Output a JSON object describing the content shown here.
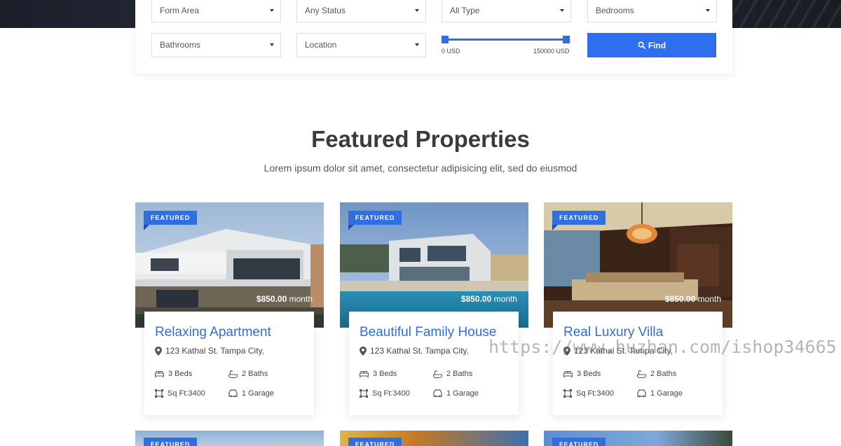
{
  "search": {
    "form_area": "Form Area",
    "status": "Any Status",
    "type": "All Type",
    "bedrooms": "Bedrooms",
    "bathrooms": "Bathrooms",
    "location": "Location",
    "price_min": "0 USD",
    "price_max": "150000 USD",
    "find_label": "Find"
  },
  "section": {
    "title": "Featured Properties",
    "subtitle": "Lorem ipsum dolor sit amet, consectetur adipisicing elit, sed do eiusmod"
  },
  "properties": [
    {
      "badge": "FEATURED",
      "price": "$850.00",
      "period": "month",
      "name": "Relaxing Apartment",
      "address": "123 Kathal St. Tampa City,",
      "beds": "3 Beds",
      "baths": "2 Baths",
      "area": "Sq Ft:3400",
      "garage": "1 Garage"
    },
    {
      "badge": "FEATURED",
      "price": "$850.00",
      "period": "month",
      "name": "Beautiful Family House",
      "address": "123 Kathal St. Tampa City,",
      "beds": "3 Beds",
      "baths": "2 Baths",
      "area": "Sq Ft:3400",
      "garage": "1 Garage"
    },
    {
      "badge": "FEATURED",
      "price": "$850.00",
      "period": "month",
      "name": "Real Luxury Villa",
      "address": "123 Kathal St. Tampa City,",
      "beds": "3 Beds",
      "baths": "2 Baths",
      "area": "Sq Ft:3400",
      "garage": "1 Garage"
    }
  ],
  "next_row": [
    {
      "badge": "FEATURED"
    },
    {
      "badge": "FEATURED"
    },
    {
      "badge": "FEATURED"
    }
  ],
  "watermark": "https://www.huzhan.com/ishop34665",
  "colors": {
    "accent": "#2f6fe0",
    "title": "#3b3b3b"
  }
}
